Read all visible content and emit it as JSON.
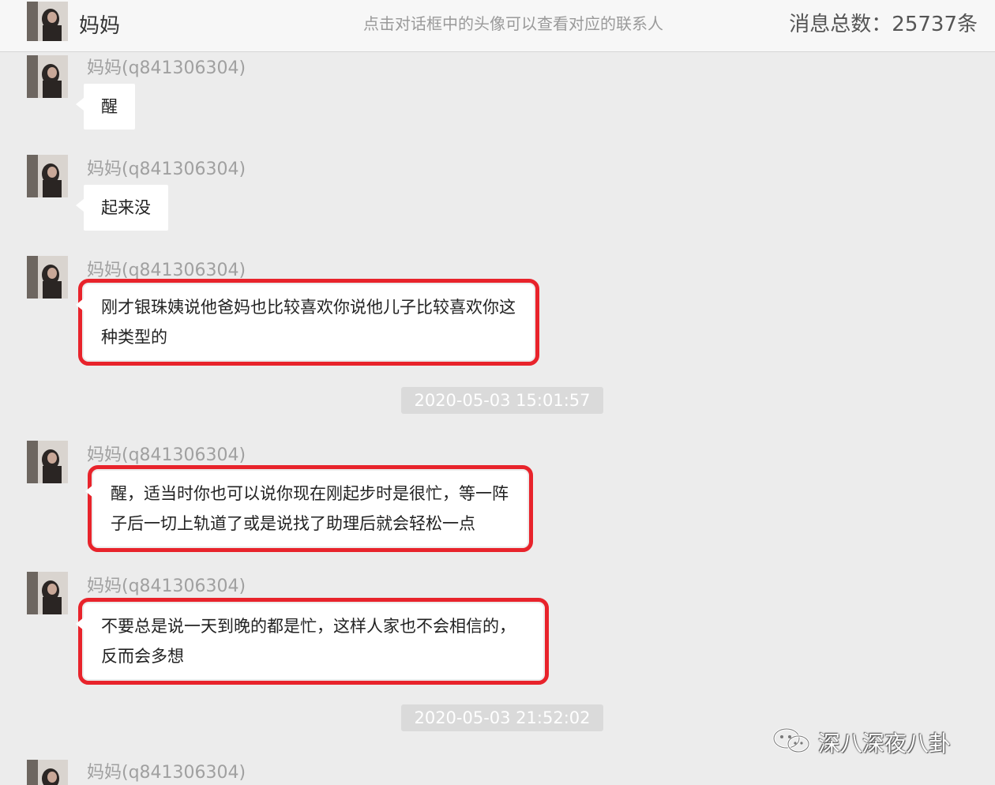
{
  "header": {
    "name": "妈妈",
    "hint": "点击对话框中的头像可以查看对应的联系人",
    "message_count": "消息总数：25737条"
  },
  "messages": [
    {
      "sender": "妈妈(q841306304)",
      "text": "醒"
    },
    {
      "sender": "妈妈(q841306304)",
      "text": "起来没"
    },
    {
      "sender": "妈妈(q841306304)",
      "text": "刚才银珠姨说他爸妈也比较喜欢你说他儿子比较喜欢你这种类型的"
    },
    {
      "sender": "妈妈(q841306304)",
      "text": "醒，适当时你也可以说你现在刚起步时是很忙，等一阵子后一切上轨道了或是说找了助理后就会轻松一点"
    },
    {
      "sender": "妈妈(q841306304)",
      "text": "不要总是说一天到晚的都是忙，这样人家也不会相信的，反而会多想"
    },
    {
      "sender": "妈妈(q841306304)",
      "text": ""
    }
  ],
  "timestamps": [
    "2020-05-03 15:01:57",
    "2020-05-03 21:52:02"
  ],
  "watermark": {
    "text": "深八深夜八卦",
    "icon": "wechat-official-account-icon"
  },
  "colors": {
    "highlight": "#e8232b",
    "bubble": "#ffffff",
    "background": "#ececec"
  }
}
